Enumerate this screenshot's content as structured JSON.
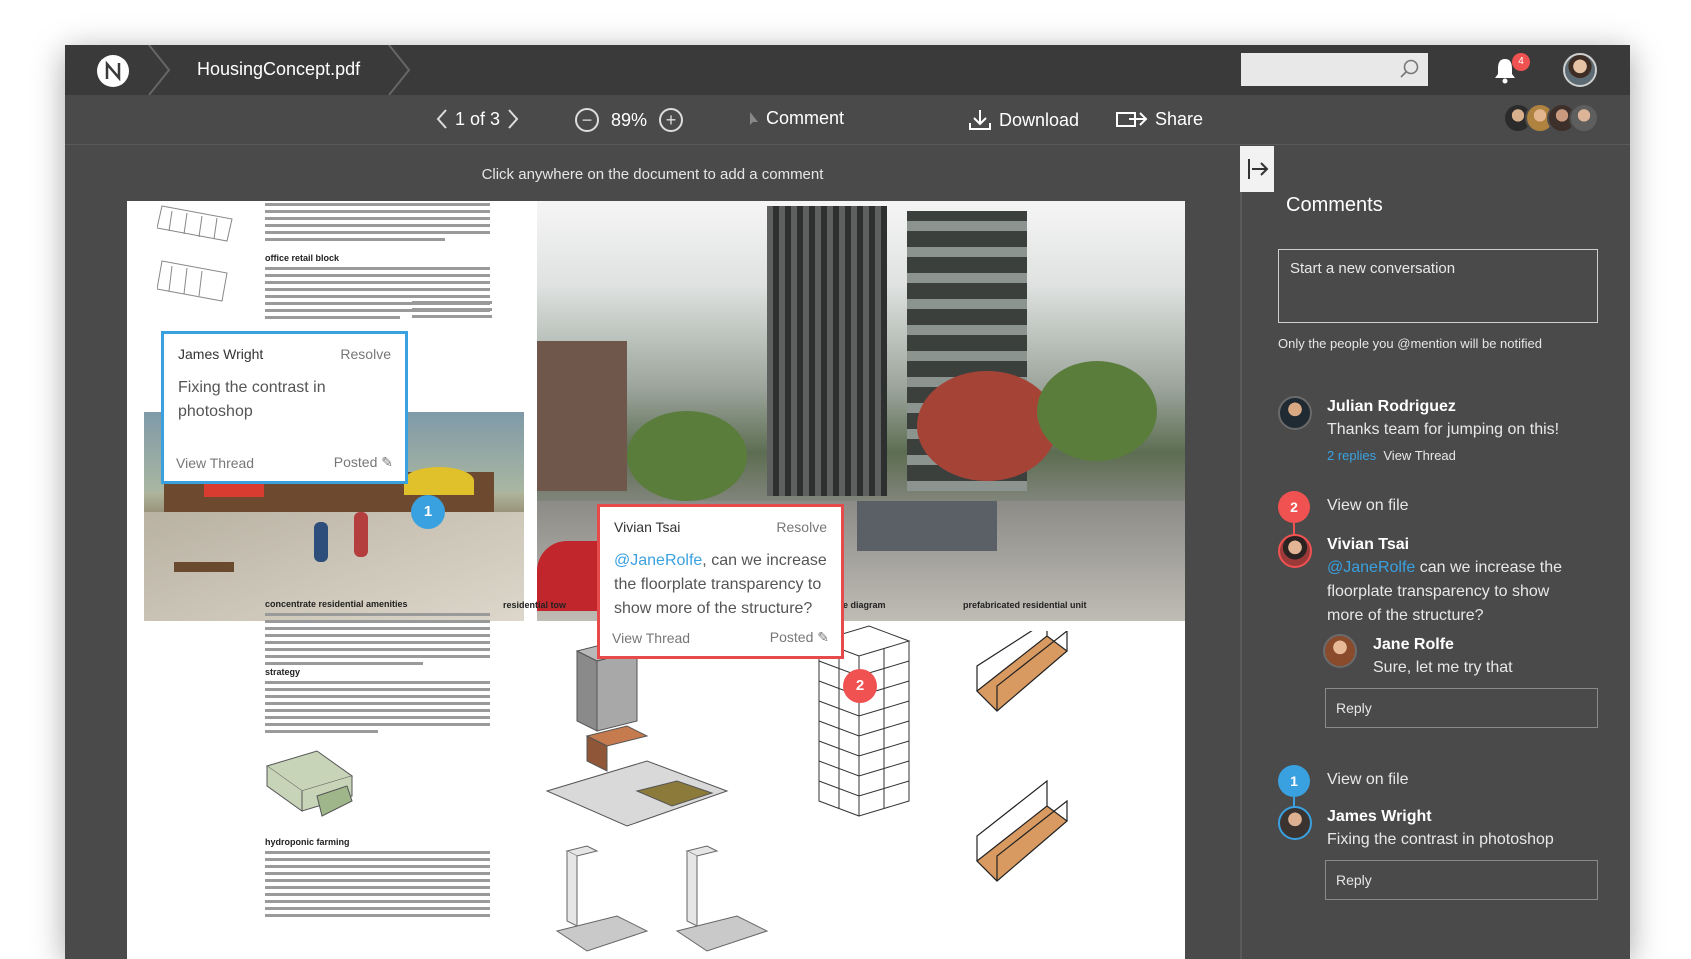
{
  "app": {
    "filename": "HousingConcept.pdf",
    "search_placeholder": "",
    "notification_count": "4"
  },
  "toolbar": {
    "page_indicator": "1 of 3",
    "zoom": "89%",
    "comment_label": "Comment",
    "download_label": "Download",
    "share_label": "Share"
  },
  "document": {
    "hint": "Click anywhere on the document to add a comment",
    "headings": {
      "office_retail": "office retail block",
      "residential_amenities": "concentrate residential amenities",
      "strategy": "strategy",
      "hydroponic": "hydroponic farming",
      "residential_tower": "residential tow",
      "structure_diagram": "structure diagram",
      "prefab_unit": "prefabricated residential unit"
    },
    "markers": {
      "m1": "1",
      "m2": "2"
    },
    "popover_james": {
      "name": "James Wright",
      "resolve": "Resolve",
      "text": "Fixing the contrast in photoshop",
      "view_thread": "View Thread",
      "posted": "Posted"
    },
    "popover_vivian": {
      "name": "Vivian Tsai",
      "resolve": "Resolve",
      "mention": "@JaneRolfe",
      "text": ", can we increase the floorplate transparency to show more of the structure?",
      "view_thread": "View Thread",
      "posted": "Posted"
    }
  },
  "sidebar": {
    "title": "Comments",
    "new_conversation_placeholder": "Start a  new conversation",
    "notify_text": "Only the people you @mention will be notified",
    "thread1": {
      "name": "Julian Rodriguez",
      "text": "Thanks team for jumping on this!",
      "replies": "2 replies",
      "view_thread": "View Thread"
    },
    "thread2": {
      "marker": "2",
      "view_on_file": "View on file",
      "name": "Vivian Tsai",
      "mention": "@JaneRolfe",
      "text": " can we increase the floorplate transparency to show more of the structure?",
      "reply_name": "Jane Rolfe",
      "reply_text": "Sure, let me try that",
      "reply_placeholder": "Reply"
    },
    "thread3": {
      "marker": "1",
      "view_on_file": "View on file",
      "name": "James Wright",
      "text": "Fixing the contrast in photoshop",
      "reply_placeholder": "Reply"
    }
  },
  "colors": {
    "accent_blue": "#3aa1e0",
    "accent_red": "#f05252",
    "topbar": "#3a3a3a",
    "panel": "#4a4a4a"
  },
  "icons": [
    "logo-icon",
    "search-icon",
    "bell-icon",
    "chevron-left-icon",
    "chevron-right-icon",
    "zoom-out-icon",
    "zoom-in-icon",
    "cursor-icon",
    "download-icon",
    "share-icon",
    "collapse-panel-icon",
    "edit-icon"
  ]
}
